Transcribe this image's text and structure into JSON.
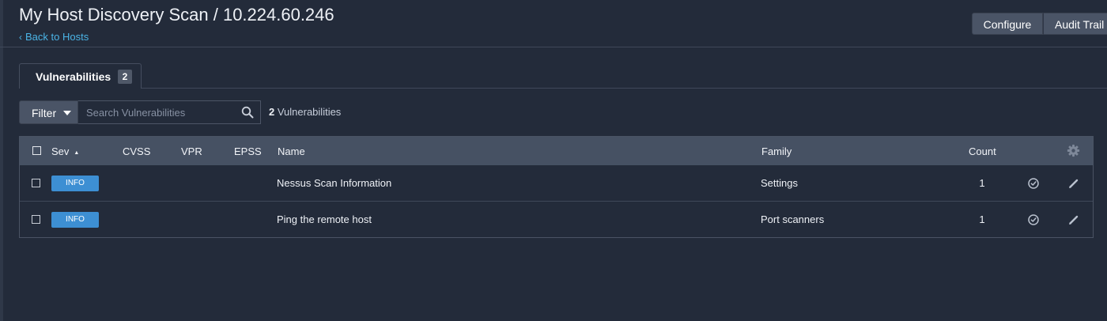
{
  "header": {
    "title": "My Host Discovery Scan / 10.224.60.246",
    "back_link": "Back to Hosts"
  },
  "toolbar": {
    "configure_label": "Configure",
    "audit_trail_label": "Audit Trail"
  },
  "tabs": [
    {
      "label": "Vulnerabilities",
      "badge": "2",
      "active": true
    }
  ],
  "filter": {
    "button_label": "Filter",
    "search_placeholder": "Search Vulnerabilities",
    "result_count": "2",
    "result_label": "Vulnerabilities"
  },
  "table": {
    "columns": {
      "sev": "Sev",
      "cvss": "CVSS",
      "vpr": "VPR",
      "epss": "EPSS",
      "name": "Name",
      "family": "Family",
      "count": "Count"
    },
    "sort_column": "Sev",
    "sort_direction": "ascending",
    "rows": [
      {
        "severity": "INFO",
        "cvss": "",
        "vpr": "",
        "epss": "",
        "name": "Nessus Scan Information",
        "family": "Settings",
        "count": "1"
      },
      {
        "severity": "INFO",
        "cvss": "",
        "vpr": "",
        "epss": "",
        "name": "Ping the remote host",
        "family": "Port scanners",
        "count": "1"
      }
    ]
  },
  "icons": {
    "back": "chevron-left-icon",
    "search": "search-icon",
    "settings": "gear-icon",
    "row_status": "check-circle-icon",
    "row_edit": "pencil-icon"
  },
  "colors": {
    "background": "#232b3a",
    "table_header": "#465163",
    "link": "#4bb4e6",
    "info_badge": "#3d8fd3",
    "button": "#4a5466"
  }
}
